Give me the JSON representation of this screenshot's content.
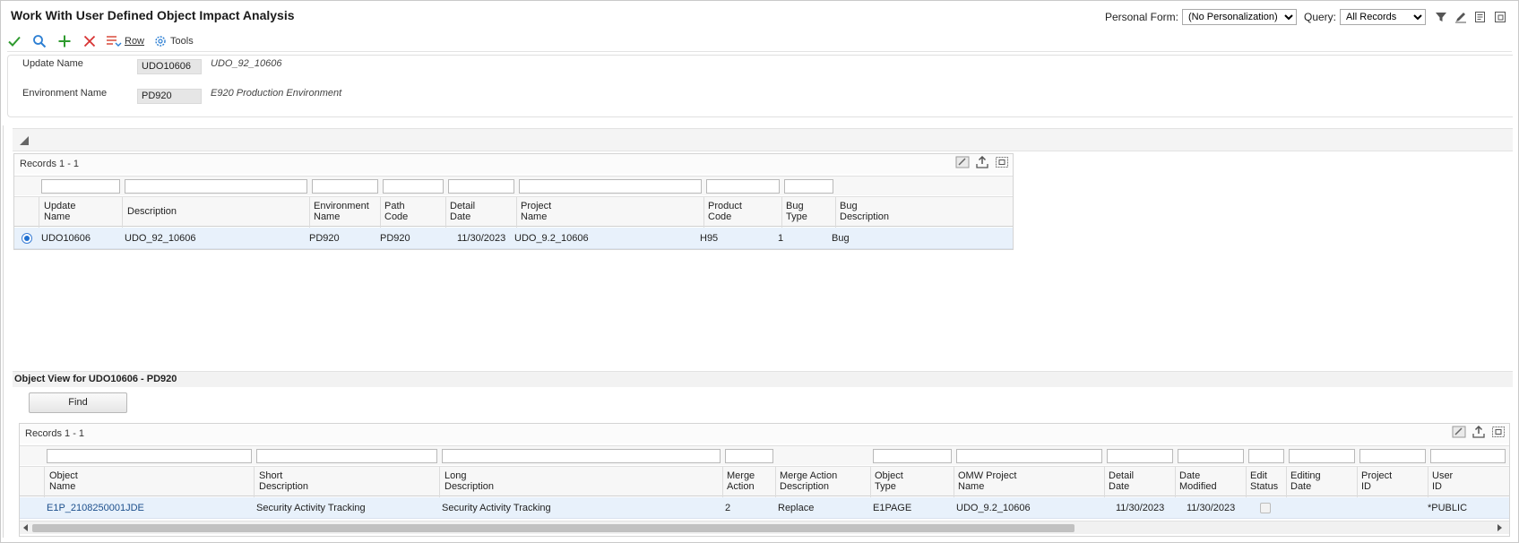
{
  "window": {
    "title": "Work With User Defined Object Impact Analysis",
    "personal_form_label": "Personal Form:",
    "personal_form_value": "(No Personalization)",
    "query_label": "Query:",
    "query_value": "All Records"
  },
  "toolbar": {
    "row_label": "Row",
    "tools_label": "Tools"
  },
  "header": {
    "update_name_label": "Update Name",
    "update_name_value": "UDO10606",
    "update_name_desc": "UDO_92_10606",
    "env_name_label": "Environment Name",
    "env_name_value": "PD920",
    "env_name_desc": "E920 Production Environment"
  },
  "grid1": {
    "records_label": "Records 1 - 1",
    "columns": {
      "c1": [
        "Update",
        "Name"
      ],
      "c2": [
        "Description"
      ],
      "c3": [
        "Environment",
        "Name"
      ],
      "c4": [
        "Path",
        "Code"
      ],
      "c5": [
        "Detail",
        "Date"
      ],
      "c6": [
        "Project",
        "Name"
      ],
      "c7": [
        "Product",
        "Code"
      ],
      "c8": [
        "Bug",
        "Type"
      ],
      "c9": [
        "Bug",
        "Description"
      ]
    },
    "row": {
      "update_name": "UDO10606",
      "description": "UDO_92_10606",
      "env_name": "PD920",
      "path_code": "PD920",
      "detail_date": "11/30/2023",
      "project_name": "UDO_9.2_10606",
      "product_code": "H95",
      "bug_type": "1",
      "bug_description": "Bug"
    }
  },
  "subform": {
    "title": "Object View for UDO10606 - PD920",
    "find_label": "Find"
  },
  "grid2": {
    "records_label": "Records 1 - 1",
    "columns": {
      "c1": [
        "Object",
        "Name"
      ],
      "c2": [
        "Short",
        "Description"
      ],
      "c3": [
        "Long",
        "Description"
      ],
      "c4": [
        "Merge",
        "Action"
      ],
      "c5": [
        "Merge Action",
        "Description"
      ],
      "c6": [
        "Object",
        "Type"
      ],
      "c7": [
        "OMW Project",
        "Name"
      ],
      "c8": [
        "Detail",
        "Date"
      ],
      "c9": [
        "Date",
        "Modified"
      ],
      "c10": [
        "Edit",
        "Status"
      ],
      "c11": [
        "Editing",
        "Date"
      ],
      "c12": [
        "Project",
        "ID"
      ],
      "c13": [
        "User",
        "ID"
      ]
    },
    "row": {
      "object_name": "E1P_2108250001JDE",
      "short_description": "Security Activity Tracking",
      "long_description": "Security Activity Tracking",
      "merge_action": "2",
      "merge_action_description": "Replace",
      "object_type": "E1PAGE",
      "omw_project_name": "UDO_9.2_10606",
      "detail_date": "11/30/2023",
      "date_modified": "11/30/2023",
      "user_id": "*PUBLIC"
    }
  }
}
